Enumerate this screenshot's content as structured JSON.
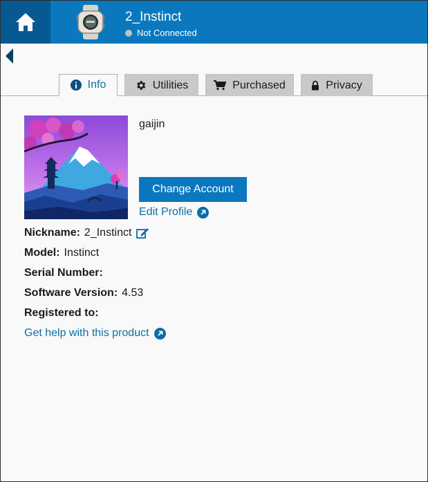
{
  "header": {
    "device_name": "2_Instinct",
    "status": "Not Connected"
  },
  "tabs": [
    {
      "label": "Info",
      "icon": "info-icon",
      "active": true
    },
    {
      "label": "Utilities",
      "icon": "gear-icon",
      "active": false
    },
    {
      "label": "Purchased",
      "icon": "cart-icon",
      "active": false
    },
    {
      "label": "Privacy",
      "icon": "lock-icon",
      "active": false
    }
  ],
  "profile": {
    "username": "gaijin",
    "change_account_label": "Change Account",
    "edit_profile_label": "Edit Profile"
  },
  "details": {
    "nickname_label": "Nickname:",
    "nickname_value": "2_Instinct",
    "model_label": "Model:",
    "model_value": "Instinct",
    "serial_label": "Serial Number:",
    "serial_value": "",
    "software_label": "Software Version:",
    "software_value": "4.53",
    "registered_label": "Registered to:",
    "registered_value": ""
  },
  "help_link_label": "Get help with this product",
  "colors": {
    "header_blue": "#0b78be",
    "home_blue": "#075a91",
    "link_blue": "#0b6ea8",
    "tab_inactive": "#c9c9c9"
  }
}
